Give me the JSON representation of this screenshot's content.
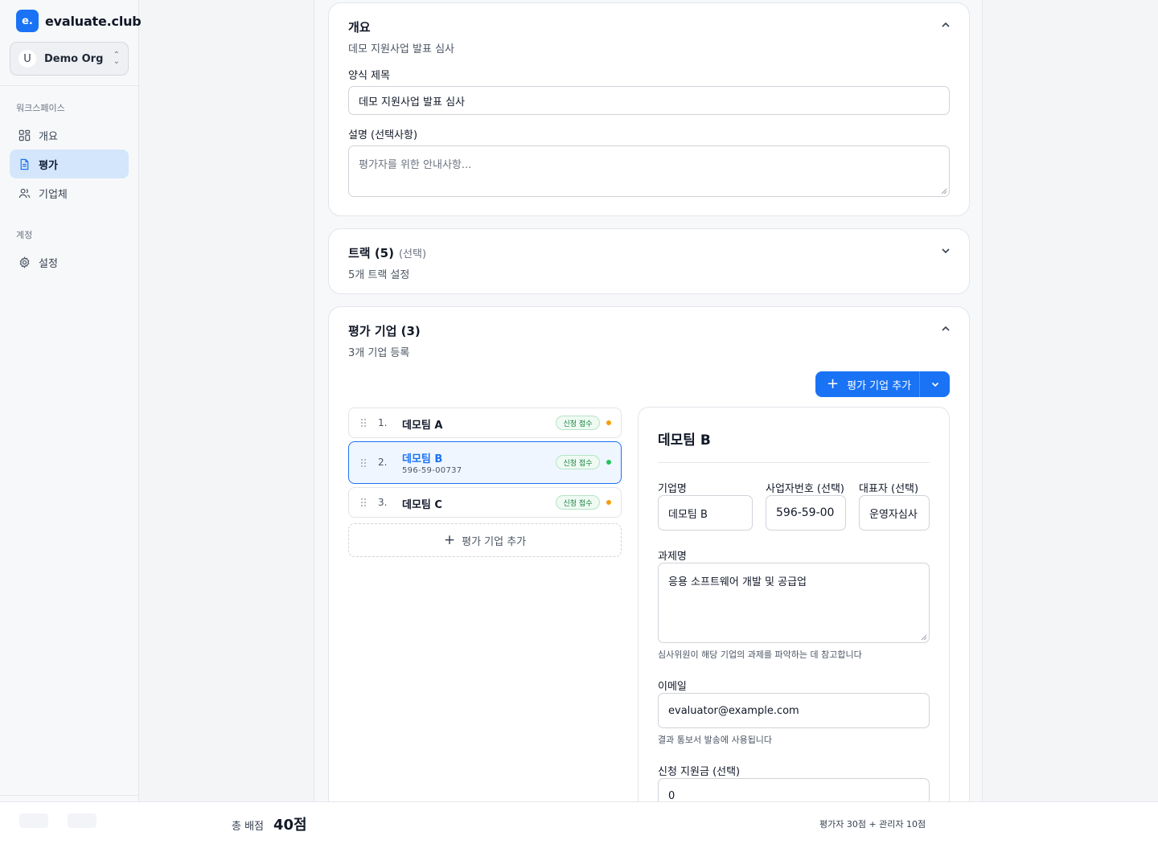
{
  "brand": {
    "logo": "e.",
    "name": "evaluate.club"
  },
  "org": {
    "avatar": "U",
    "name": "Demo Org"
  },
  "sidebar": {
    "workspace_label": "워크스페이스",
    "account_label": "계정",
    "items": [
      {
        "label": "개요",
        "icon": "grid-icon"
      },
      {
        "label": "평가",
        "icon": "document-icon"
      },
      {
        "label": "기업체",
        "icon": "users-icon"
      },
      {
        "label": "설정",
        "icon": "gear-icon"
      }
    ]
  },
  "overview": {
    "title": "개요",
    "subtitle": "데모 지원사업 발표 심사",
    "form_title_label": "양식 제목",
    "form_title_value": "데모 지원사업 발표 심사",
    "description_label": "설명 (선택사항)",
    "description_placeholder": "평가자를 위한 안내사항..."
  },
  "tracks": {
    "title": "트랙 (5)",
    "optional": "(선택)",
    "subtitle": "5개 트랙 설정"
  },
  "companies": {
    "title": "평가 기업 (3)",
    "subtitle": "3개 기업 등록",
    "add_label": "평가 기업 추가",
    "list": [
      {
        "num": "1.",
        "name": "데모팀 A",
        "biz": "",
        "status": "신청 접수",
        "dot": "#f59e0b"
      },
      {
        "num": "2.",
        "name": "데모팀 B",
        "biz": "596-59-00737",
        "status": "신청 접수",
        "dot": "#22c55e"
      },
      {
        "num": "3.",
        "name": "데모팀 C",
        "biz": "",
        "status": "신청 접수",
        "dot": "#f59e0b"
      }
    ],
    "add_dashed_label": "평가 기업 추가"
  },
  "detail": {
    "title": "데모팀 B",
    "company_name_label": "기업명",
    "company_name_value": "데모팀 B",
    "biz_no_label": "사업자번호 (선택)",
    "biz_no_value": "596-59-00",
    "ceo_label": "대표자 (선택)",
    "ceo_value": "운영자심사",
    "project_label": "과제명",
    "project_value": "응용 소프트웨어 개발 및 공급업",
    "project_help": "심사위원이 해당 기업의 과제를 파악하는 데 참고합니다",
    "email_label": "이메일",
    "email_value": "evaluator@example.com",
    "email_help": "결과 통보서 발송에 사용됩니다",
    "grant_label": "신청 지원금 (선택)",
    "grant_value": "0"
  },
  "footer": {
    "total_label": "총 배점",
    "total_value": "40점",
    "breakdown": "평가자 30점 + 관리자 10점"
  },
  "colors": {
    "accent": "#1a73f5",
    "active_nav": "#d4e6fb",
    "badge_green": "#15803d"
  }
}
